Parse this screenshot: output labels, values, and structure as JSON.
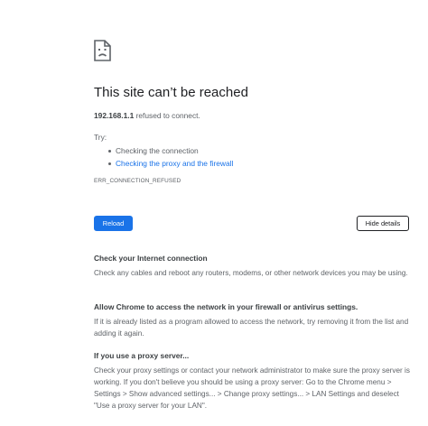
{
  "error": {
    "title": "This site can’t be reached",
    "host": "192.168.1.1",
    "summary_suffix": " refused to connect.",
    "try_label": "Try:",
    "suggestions": [
      {
        "label": "Checking the connection",
        "is_link": false
      },
      {
        "label": "Checking the proxy and the firewall",
        "is_link": true
      }
    ],
    "code": "ERR_CONNECTION_REFUSED",
    "icon": "sad-page-icon"
  },
  "buttons": {
    "reload_label": "Reload",
    "details_label": "Hide details"
  },
  "details": {
    "sections": [
      {
        "heading": "Check your Internet connection",
        "body": "Check any cables and reboot any routers, modems, or other network devices you may be using."
      },
      {
        "heading": "Allow Chrome to access the network in your firewall or antivirus settings.",
        "body": "If it is already listed as a program allowed to access the network, try removing it from the list and adding it again."
      },
      {
        "heading": "If you use a proxy server...",
        "body": "Check your proxy settings or contact your network administrator to make sure the proxy server is working. If you don't believe you should be using a proxy server: Go to the Chrome menu > Settings > Show advanced settings... > Change proxy settings... > LAN Settings and deselect \"Use a proxy server for your LAN\"."
      }
    ]
  },
  "colors": {
    "accent": "#1a73e8",
    "text_primary": "#202124",
    "text_secondary": "#5f6368"
  }
}
